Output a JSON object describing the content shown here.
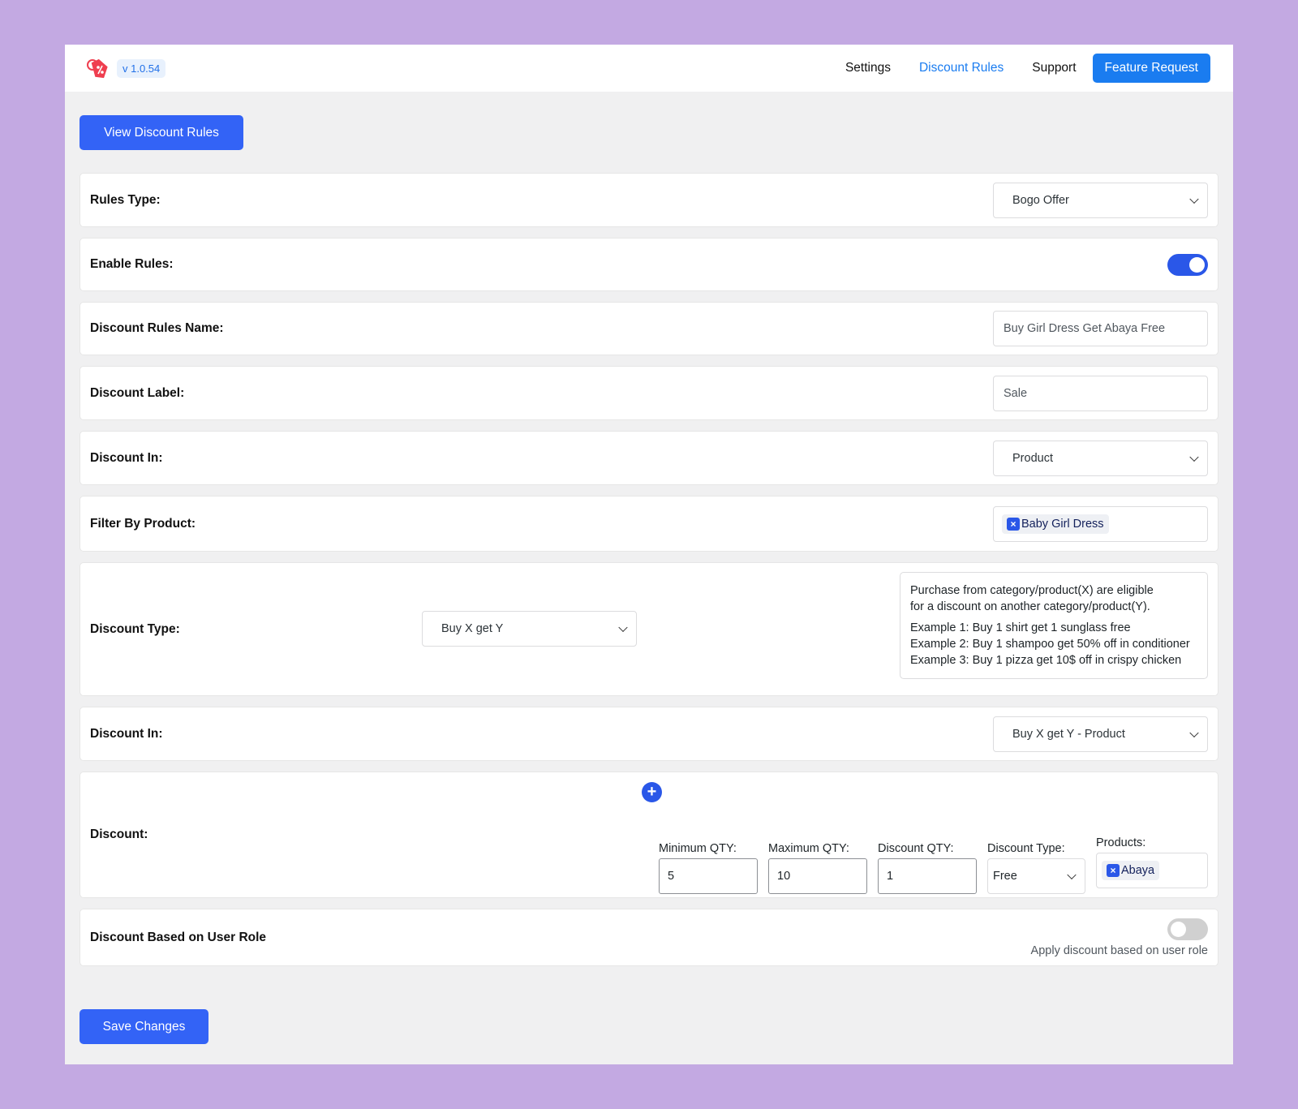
{
  "header": {
    "logo_icon": "discount-tag-icon",
    "version": "v 1.0.54",
    "nav": [
      {
        "label": "Settings",
        "active": false
      },
      {
        "label": "Discount Rules",
        "active": true
      },
      {
        "label": "Support",
        "active": false
      }
    ],
    "feature_request_label": "Feature Request"
  },
  "view_rules_label": "View Discount Rules",
  "form": {
    "rules_type": {
      "label": "Rules Type:",
      "value": "Bogo Offer"
    },
    "enable_rules": {
      "label": "Enable Rules:",
      "enabled": true
    },
    "rules_name": {
      "label": "Discount Rules Name:",
      "value": "Buy Girl Dress Get Abaya Free"
    },
    "discount_label": {
      "label": "Discount Label:",
      "value": "Sale"
    },
    "discount_in": {
      "label": "Discount In:",
      "value": "Product"
    },
    "filter_by_product": {
      "label": "Filter By Product:",
      "tags": [
        "Baby Girl Dress"
      ],
      "remove_icon": "x-icon"
    },
    "discount_type": {
      "label": "Discount Type:",
      "value": "Buy X get Y",
      "info": {
        "line1": "Purchase from category/product(X) are eligible",
        "line2": "for a discount on another category/product(Y).",
        "example1": "Example 1: Buy 1 shirt get 1 sunglass free",
        "example2": "Example 2: Buy 1 shampoo get 50% off in conditioner",
        "example3": "Example 3: Buy 1 pizza get 10$ off in crispy chicken"
      }
    },
    "discount_in_2": {
      "label": "Discount In:",
      "value": "Buy X get Y - Product"
    },
    "discount": {
      "label": "Discount:",
      "add_icon": "plus-icon",
      "min_qty": {
        "label": "Minimum QTY:",
        "value": "5"
      },
      "max_qty": {
        "label": "Maximum QTY:",
        "value": "10"
      },
      "discount_qty": {
        "label": "Discount QTY:",
        "value": "1"
      },
      "discount_type": {
        "label": "Discount Type:",
        "value": "Free"
      },
      "products": {
        "label": "Products:",
        "tags": [
          "Abaya"
        ]
      }
    },
    "user_role": {
      "label": "Discount Based on User Role",
      "enabled": false,
      "help": "Apply discount based on user role"
    }
  },
  "save_label": "Save Changes",
  "colors": {
    "accent": "#3363f6",
    "nav_active": "#1a7cf0",
    "toggle_on": "#2a57e8",
    "background": "#c3a9e2"
  }
}
